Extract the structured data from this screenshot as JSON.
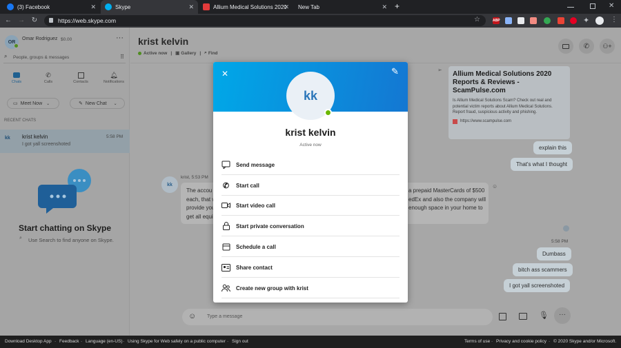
{
  "browser": {
    "tabs": [
      {
        "label": "(3) Facebook",
        "color": "#1877f2"
      },
      {
        "label": "Skype",
        "color": "#00aff0"
      },
      {
        "label": "Allium Medical Solutions 2020 R",
        "color": "#e33b3b"
      },
      {
        "label": "New Tab",
        "color": ""
      }
    ],
    "new_tab_symbol": "+",
    "url": "https://web.skype.com",
    "ext_abp": "ABP"
  },
  "sidebar": {
    "profile_initials": "OR",
    "profile_name": "Omar Rodriguez",
    "profile_balance": "$0.00",
    "search_placeholder": "People, groups & messages",
    "nav": [
      {
        "label": "Chats"
      },
      {
        "label": "Calls"
      },
      {
        "label": "Contacts"
      },
      {
        "label": "Notifications"
      }
    ],
    "meet_now": "Meet Now",
    "new_chat": "New Chat",
    "recent_header": "RECENT CHATS",
    "recent": [
      {
        "initials": "kk",
        "name": "krist kelvin",
        "time": "5:58 PM",
        "preview": "I got yall screenshoted"
      }
    ],
    "empty_title": "Start chatting on Skype",
    "empty_sub": "Use Search to find anyone on Skype."
  },
  "conversation": {
    "name": "krist kelvin",
    "status": "Active now",
    "gallery": "Gallery",
    "find": "Find",
    "link_preview": {
      "title": "Allium Medical Solutions 2020 Reports & Reviews - ScamPulse.com",
      "description": "Is Allium Medical Solutions Scam? Check out real and potential victim reports about Allium Medical Solutions. Report fraud, suspicious activity and phishing.",
      "site": "https://www.scampulse.com"
    },
    "out_msg_1": "explain this",
    "out_msg_2": "That's what I thought",
    "sender": "krist",
    "sender_time": "5:53 PM",
    "in_initials": "kk",
    "in_left_1": "The accou",
    "in_left_2": "each, that w",
    "in_left_3": "provide you",
    "in_left_4": "get all equi",
    "in_right_1": "a prepaid MasterCards of $500",
    "in_right_2": "edEx and also the company will",
    "in_right_3": "enough space in your home to",
    "time_2": "5:58 PM",
    "out_msg_3": "Dumbass",
    "out_msg_4": "bitch ass scammers",
    "out_msg_5": "I got yall screenshoted",
    "compose_placeholder": "Type a message"
  },
  "modal": {
    "initials": "kk",
    "name": "krist kelvin",
    "status": "Active now",
    "actions": [
      {
        "label": "Send message"
      },
      {
        "label": "Start call"
      },
      {
        "label": "Start video call"
      },
      {
        "label": "Start private conversation"
      },
      {
        "label": "Schedule a call"
      },
      {
        "label": "Share contact"
      },
      {
        "label": "Create new group with krist"
      }
    ]
  },
  "footer": {
    "left": [
      "Download Desktop App",
      "Feedback",
      "Language (en-US)",
      "Using Skype for Web safely on a public computer",
      "Sign out"
    ],
    "right": [
      "Terms of use",
      "Privacy and cookie policy",
      "© 2020 Skype and/or Microsoft."
    ]
  },
  "colors": {
    "accent": "#00aff0",
    "presence": "#6bb700"
  }
}
